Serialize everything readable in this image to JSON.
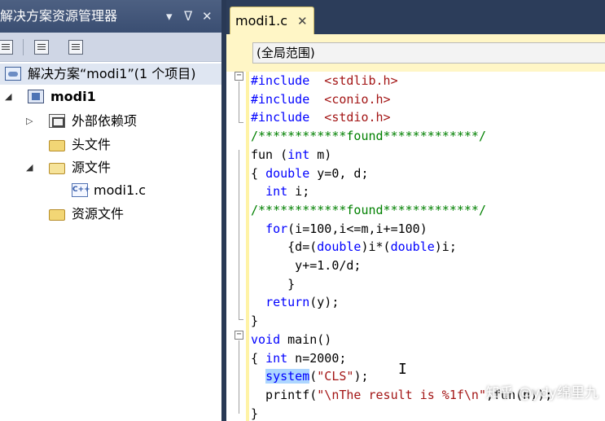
{
  "solution_explorer": {
    "title": "解决方案资源管理器",
    "controls": {
      "dropdown": "▾",
      "pin": "ᐁ",
      "close": "✕"
    },
    "toolbar_icons": [
      "properties-icon",
      "show-all-files-icon",
      "refresh-icon"
    ],
    "tree": {
      "solution": "解决方案“modi1”(1 个项目)",
      "project": "modi1",
      "external_deps": "外部依赖项",
      "header_files": "头文件",
      "source_files": "源文件",
      "source_file_1": "modi1.c",
      "resource_files": "资源文件"
    },
    "expanders": {
      "project": "◢",
      "external_deps": "▷",
      "source_files": "◢"
    },
    "icon_labels": {
      "cpp": "C++"
    }
  },
  "editor": {
    "tab": {
      "label": "modi1.c",
      "close": "✕"
    },
    "scope": "(全局范围)",
    "fold_markers": {
      "collapse": "−"
    },
    "code_lines": [
      [
        {
          "t": "#include",
          "c": "pp"
        },
        {
          "t": "  <stdlib.h>",
          "c": "str"
        }
      ],
      [
        {
          "t": "#include",
          "c": "pp"
        },
        {
          "t": "  <conio.h>",
          "c": "str"
        }
      ],
      [
        {
          "t": "#include",
          "c": "pp"
        },
        {
          "t": "  <stdio.h>",
          "c": "str"
        }
      ],
      [
        {
          "t": "/************found*************/",
          "c": "cm"
        }
      ],
      [
        {
          "t": "fun",
          "c": "tx"
        },
        {
          "t": " (",
          "c": "tx"
        },
        {
          "t": "int",
          "c": "kw"
        },
        {
          "t": " m)",
          "c": "tx"
        }
      ],
      [
        {
          "t": "{ ",
          "c": "tx"
        },
        {
          "t": "double",
          "c": "kw"
        },
        {
          "t": " y=0, d;",
          "c": "tx"
        }
      ],
      [
        {
          "t": "  ",
          "c": "tx"
        },
        {
          "t": "int",
          "c": "kw"
        },
        {
          "t": " i;",
          "c": "tx"
        }
      ],
      [
        {
          "t": "/************found*************/",
          "c": "cm"
        }
      ],
      [
        {
          "t": "  ",
          "c": "tx"
        },
        {
          "t": "for",
          "c": "kw"
        },
        {
          "t": "(i=100,i<=m,i+=100)",
          "c": "tx"
        }
      ],
      [
        {
          "t": "     {d=(",
          "c": "tx"
        },
        {
          "t": "double",
          "c": "kw"
        },
        {
          "t": ")i*(",
          "c": "tx"
        },
        {
          "t": "double",
          "c": "kw"
        },
        {
          "t": ")i;",
          "c": "tx"
        }
      ],
      [
        {
          "t": "      y+=1.0/d;",
          "c": "tx"
        }
      ],
      [
        {
          "t": "     }",
          "c": "tx"
        }
      ],
      [
        {
          "t": "  ",
          "c": "tx"
        },
        {
          "t": "return",
          "c": "kw"
        },
        {
          "t": "(y);",
          "c": "tx"
        }
      ],
      [
        {
          "t": "}",
          "c": "tx"
        }
      ],
      [
        {
          "t": "void",
          "c": "kw"
        },
        {
          "t": " main()",
          "c": "tx"
        }
      ],
      [
        {
          "t": "{ ",
          "c": "tx"
        },
        {
          "t": "int",
          "c": "kw"
        },
        {
          "t": " n=2000;",
          "c": "tx"
        }
      ],
      [
        {
          "t": "  ",
          "c": "tx"
        },
        {
          "t": "system",
          "c": "sel"
        },
        {
          "t": "(",
          "c": "tx"
        },
        {
          "t": "\"CLS\"",
          "c": "str"
        },
        {
          "t": ");",
          "c": "tx"
        }
      ],
      [
        {
          "t": "  printf(",
          "c": "tx"
        },
        {
          "t": "\"\\nThe result is %1f\\n\"",
          "c": "str"
        },
        {
          "t": ",fun(n));",
          "c": "tx"
        }
      ],
      [
        {
          "t": "}",
          "c": "tx"
        }
      ]
    ]
  },
  "watermark": "知乎 @ydy绵里九"
}
